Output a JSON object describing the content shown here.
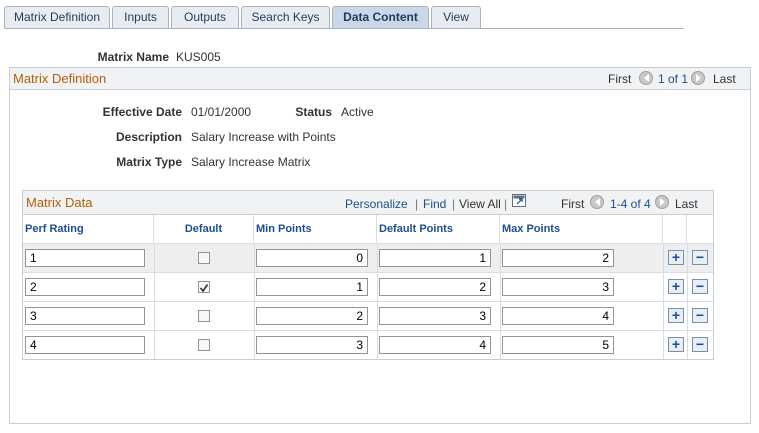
{
  "tabs": [
    {
      "label": "Matrix Definition",
      "active": false
    },
    {
      "label": "Inputs",
      "active": false
    },
    {
      "label": "Outputs",
      "active": false
    },
    {
      "label": "Search Keys",
      "active": false
    },
    {
      "label": "Data Content",
      "active": true
    },
    {
      "label": "View",
      "active": false
    }
  ],
  "matrix_name": {
    "label": "Matrix Name",
    "value": "KUS005"
  },
  "definition": {
    "title": "Matrix Definition",
    "nav": {
      "first": "First",
      "count": "1 of 1",
      "last": "Last"
    },
    "effective_date": {
      "label": "Effective Date",
      "value": "01/01/2000"
    },
    "status": {
      "label": "Status",
      "value": "Active"
    },
    "description": {
      "label": "Description",
      "value": "Salary Increase with Points"
    },
    "matrix_type": {
      "label": "Matrix Type",
      "value": "Salary Increase Matrix"
    }
  },
  "grid": {
    "title": "Matrix Data",
    "personalize": "Personalize",
    "find": "Find",
    "view_all": "View All",
    "sep": "|",
    "nav": {
      "first": "First",
      "count": "1-4 of 4",
      "last": "Last"
    },
    "columns": [
      "Perf Rating",
      "Default",
      "Min Points",
      "Default Points",
      "Max Points"
    ],
    "rows": [
      {
        "perf_rating": "1",
        "default": false,
        "min_points": "0",
        "default_points": "1",
        "max_points": "2"
      },
      {
        "perf_rating": "2",
        "default": true,
        "min_points": "1",
        "default_points": "2",
        "max_points": "3"
      },
      {
        "perf_rating": "3",
        "default": false,
        "min_points": "2",
        "default_points": "3",
        "max_points": "4"
      },
      {
        "perf_rating": "4",
        "default": false,
        "min_points": "3",
        "default_points": "4",
        "max_points": "5"
      }
    ],
    "add_symbol": "+",
    "delete_symbol": "−"
  },
  "colors": {
    "accent_title": "#b45f06",
    "link": "#1f4e8c",
    "active_tab": "#c9d7e6"
  }
}
